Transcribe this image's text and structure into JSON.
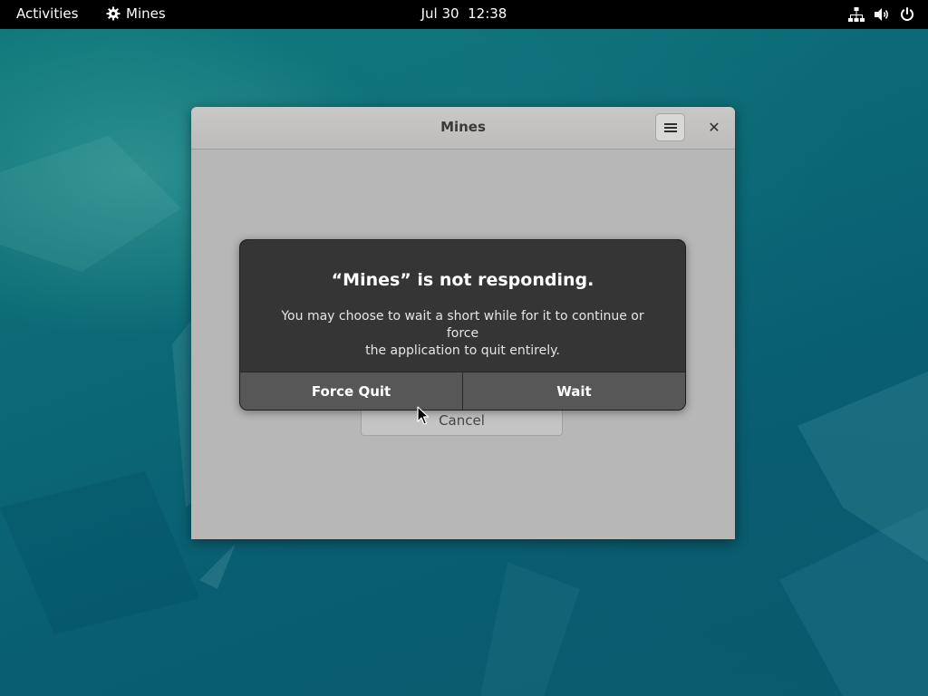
{
  "topbar": {
    "activities_label": "Activities",
    "app_name": "Mines",
    "app_icon": "gear-icon",
    "date": "Jul 30",
    "time": "12:38",
    "tray_icons": [
      "network-icon",
      "volume-icon",
      "power-icon"
    ]
  },
  "window": {
    "title": "Mines",
    "menu_icon": "hamburger-menu-icon",
    "close_icon": "close-icon",
    "close_glyph": "✕",
    "cancel_label": "Cancel"
  },
  "dialog": {
    "title": "“Mines” is not responding.",
    "body_line1": "You may choose to wait a short while for it to continue or force",
    "body_line2": "the application to quit entirely.",
    "force_quit_label": "Force Quit",
    "wait_label": "Wait"
  },
  "colors": {
    "desktop": "#0d5a66",
    "topbar": "#000000",
    "window_bg": "#b7b7b7",
    "dialog_bg": "#353535",
    "dialog_button": "#575757"
  }
}
